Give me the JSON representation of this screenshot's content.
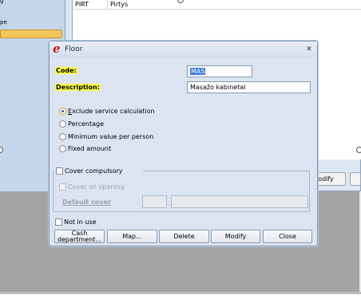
{
  "background": {
    "left_items": [
      "g",
      "pe"
    ],
    "list_row": {
      "col1": "PIRT",
      "col2": "Pirtys"
    },
    "modify_label": "odify"
  },
  "dialog": {
    "title": "Floor",
    "app_icon_glyph": "e",
    "close_glyph": "✕",
    "code_label": "Code:",
    "code_value": "MAS",
    "description_label": "Description:",
    "description_value": "Masažo kabinetai",
    "radio_options": [
      {
        "label": "Exclude service calculation",
        "selected": true
      },
      {
        "label": "Percentage",
        "selected": false
      },
      {
        "label": "Minimum value per person",
        "selected": false
      },
      {
        "label": "Fixed amount",
        "selected": false
      }
    ],
    "cover_compulsory_label": "Cover compulsory",
    "cover_on_opening_label": "Cover on opening",
    "default_cover_label": "Default cover",
    "not_in_use_label": "Not in use",
    "buttons": {
      "cash_department": "Cash department...",
      "map": "Map...",
      "delete": "Delete",
      "modify": "Modify",
      "close": "Close"
    }
  },
  "colors": {
    "highlight": "#ffff4a",
    "selection": "#3a79d6",
    "app_icon": "#c01b1b"
  }
}
